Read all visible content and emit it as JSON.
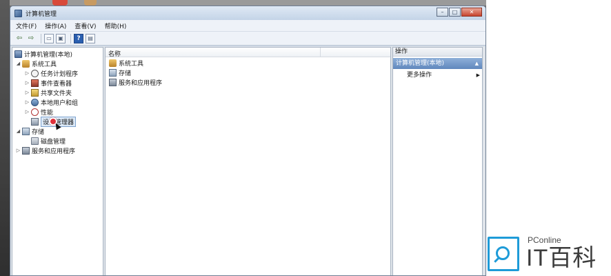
{
  "window": {
    "title": "计算机管理",
    "controls": {
      "minimize": "–",
      "maximize": "□",
      "close": "✕"
    }
  },
  "menu": [
    {
      "label": "文件(F)"
    },
    {
      "label": "操作(A)"
    },
    {
      "label": "查看(V)"
    },
    {
      "label": "帮助(H)"
    }
  ],
  "toolbar": {
    "back": "⇦",
    "forward": "⇨",
    "btn3": "▭",
    "btn4": "▣",
    "help": "?",
    "btn6": "▤"
  },
  "tree": {
    "items": [
      {
        "label": "计算机管理(本地)",
        "expander": ""
      },
      {
        "label": "系统工具",
        "expander": "◢"
      },
      {
        "label": "任务计划程序",
        "expander": "▷"
      },
      {
        "label": "事件查看器",
        "expander": "▷"
      },
      {
        "label": "共享文件夹",
        "expander": "▷"
      },
      {
        "label": "本地用户和组",
        "expander": "▷"
      },
      {
        "label": "性能",
        "expander": "▷"
      },
      {
        "label": "设备管理器",
        "expander": ""
      },
      {
        "label": "存储",
        "expander": "◢"
      },
      {
        "label": "磁盘管理",
        "expander": ""
      },
      {
        "label": "服务和应用程序",
        "expander": "▷"
      }
    ]
  },
  "list": {
    "header": "名称",
    "items": [
      {
        "label": "系统工具"
      },
      {
        "label": "存储"
      },
      {
        "label": "服务和应用程序"
      }
    ]
  },
  "actions": {
    "header": "操作",
    "group": "计算机管理(本地)",
    "group_arrow": "▲",
    "more": "更多操作",
    "more_arrow": "▶"
  },
  "watermark": {
    "small": "PConline",
    "big": "IT百科"
  }
}
